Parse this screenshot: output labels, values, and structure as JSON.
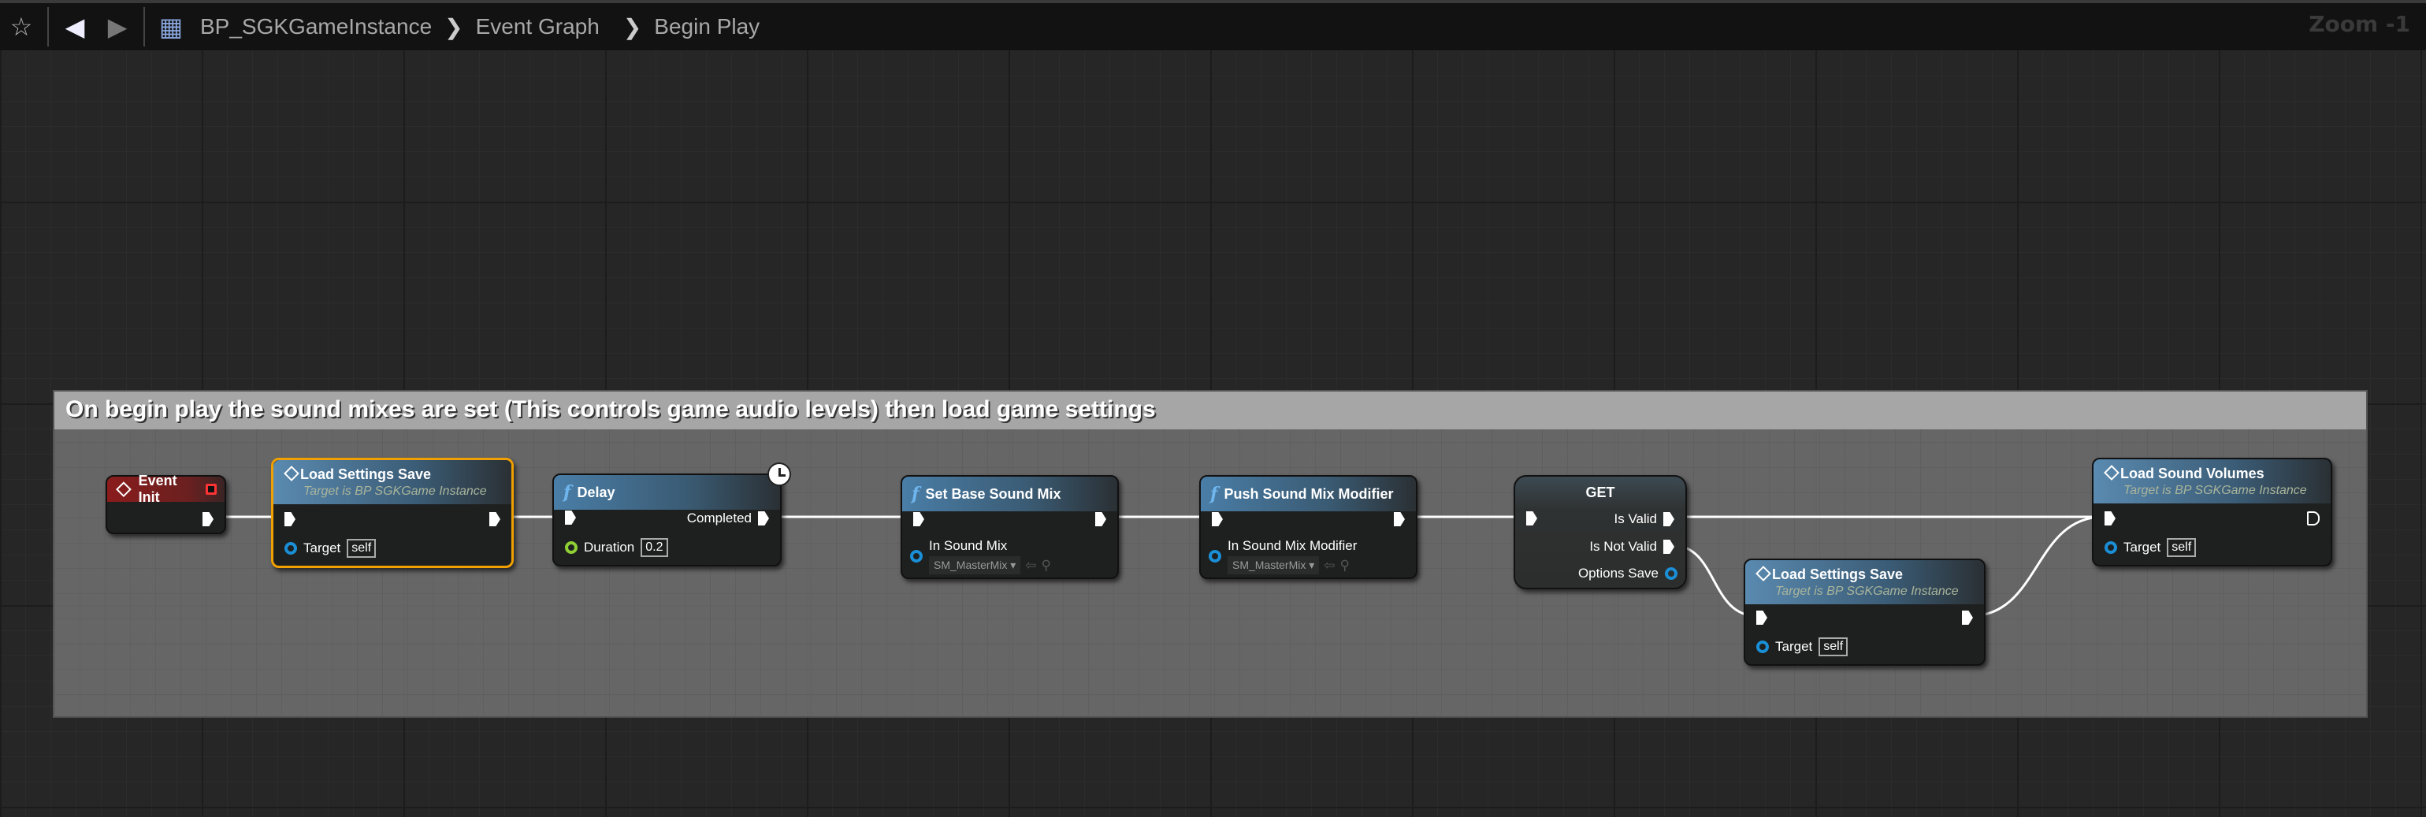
{
  "toolbar": {
    "breadcrumbs": [
      "BP_SGKGameInstance",
      "Event Graph",
      "Begin Play"
    ],
    "zoom": "Zoom -1",
    "icons": [
      "star-icon",
      "back-arrow-icon",
      "forward-arrow-icon",
      "blueprint-icon"
    ]
  },
  "comment": {
    "text": "On begin play the sound mixes are set (This controls game audio levels) then load game settings"
  },
  "nodes": {
    "event_init": {
      "title": "Event Init"
    },
    "load_settings_1": {
      "title": "Load Settings Save",
      "subtitle": "Target is BP SGKGame Instance",
      "target_label": "Target",
      "target_value": "self"
    },
    "delay": {
      "title": "Delay",
      "completed": "Completed",
      "duration_label": "Duration",
      "duration_value": "0.2"
    },
    "set_base": {
      "title": "Set Base Sound Mix",
      "pin_label": "In Sound Mix",
      "pin_value": "SM_MasterMix"
    },
    "push_mod": {
      "title": "Push Sound Mix Modifier",
      "pin_label": "In Sound Mix Modifier",
      "pin_value": "SM_MasterMix"
    },
    "get": {
      "title": "GET",
      "is_valid": "Is Valid",
      "is_not_valid": "Is Not Valid",
      "options_save": "Options Save"
    },
    "load_settings_2": {
      "title": "Load Settings Save",
      "subtitle": "Target is BP SGKGame Instance",
      "target_label": "Target",
      "target_value": "self"
    },
    "load_volumes": {
      "title": "Load Sound Volumes",
      "subtitle": "Target is BP SGKGame Instance",
      "target_label": "Target",
      "target_value": "self"
    }
  },
  "colors": {
    "selected": "#f0a000",
    "event": "#8a1c1c",
    "function": "#4a7ea7",
    "object_pin": "#1a8fd6",
    "float_pin": "#8fd034"
  }
}
